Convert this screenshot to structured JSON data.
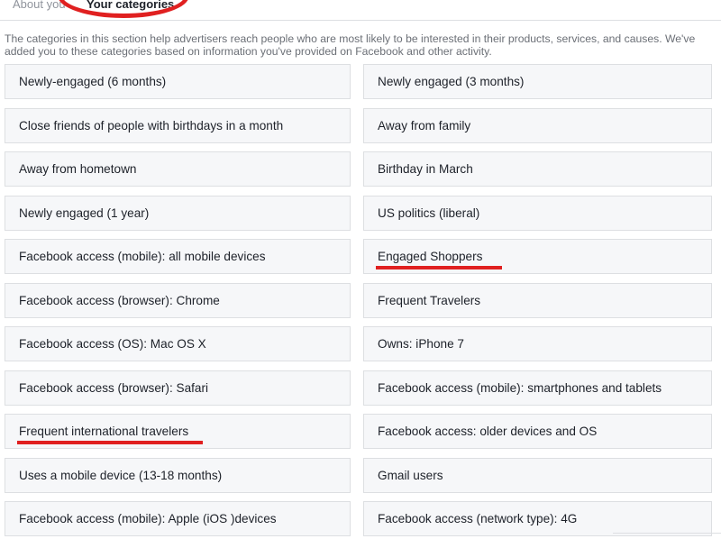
{
  "tabs": {
    "about_label": "About you",
    "categories_label": "Your categories"
  },
  "description": "The categories in this section help advertisers reach people who are most likely to be interested in their products, services, and causes. We've added you to these categories based on information you've provided on Facebook and other activity.",
  "categories": [
    "Newly-engaged (6 months)",
    "Newly engaged (3 months)",
    "Close friends of people with birthdays in a month",
    "Away from family",
    "Away from hometown",
    "Birthday in March",
    "Newly engaged (1 year)",
    "US politics (liberal)",
    "Facebook access (mobile): all mobile devices",
    "Engaged Shoppers",
    "Facebook access (browser): Chrome",
    "Frequent Travelers",
    "Facebook access (OS): Mac OS X",
    "Owns: iPhone 7",
    "Facebook access (browser): Safari",
    "Facebook access (mobile): smartphones and tablets",
    "Frequent international travelers",
    "Facebook access: older devices and OS",
    "Uses a mobile device (13-18 months)",
    "Gmail users",
    "Facebook access (mobile): Apple (iOS )devices",
    "Facebook access (network type): 4G"
  ],
  "annotation_color": "#e02020"
}
